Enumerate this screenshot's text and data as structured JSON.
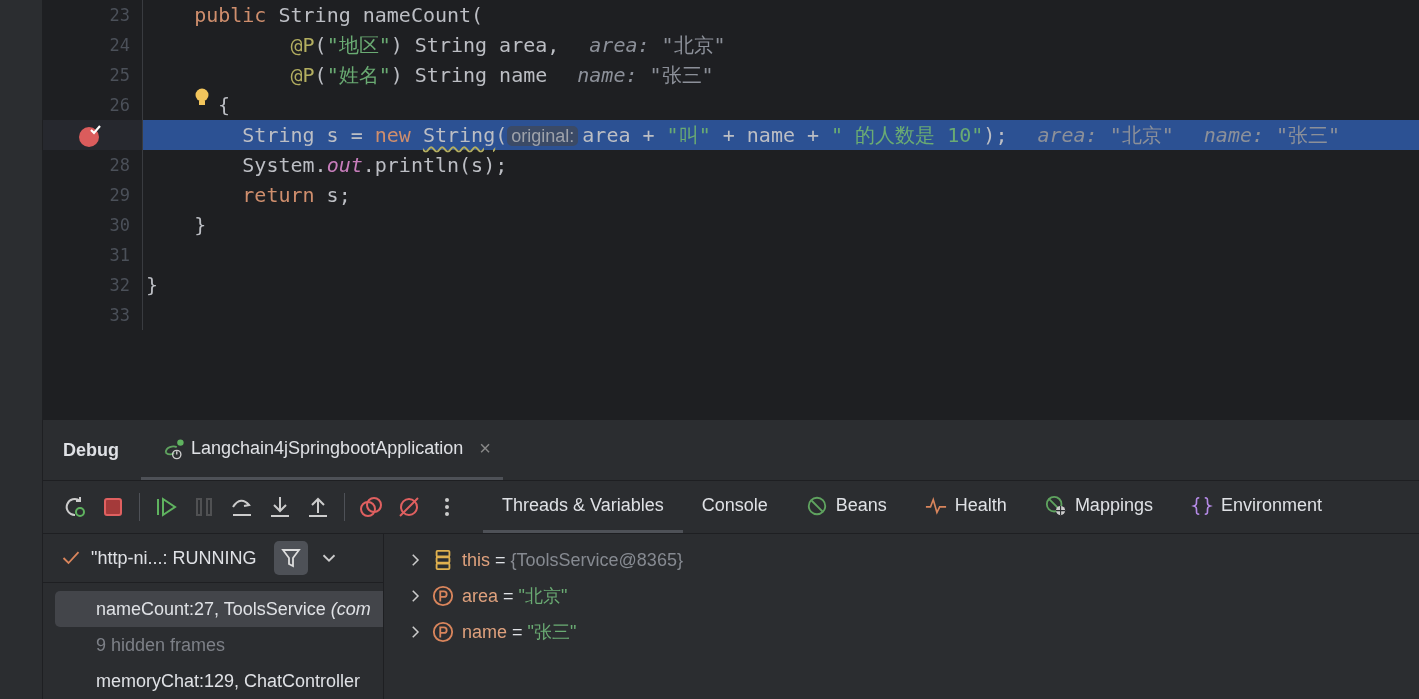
{
  "editor": {
    "lines": [
      {
        "number": "23",
        "current": false,
        "tokens": [
          {
            "t": "    public",
            "kind": "kw"
          },
          {
            "t": " String nameCount(",
            "kind": "plain"
          }
        ]
      },
      {
        "number": "24",
        "current": false,
        "tokens": [
          {
            "t": "            @P",
            "kind": "ann"
          },
          {
            "t": "(",
            "kind": "plain"
          },
          {
            "t": "\"地区\"",
            "kind": "str"
          },
          {
            "t": ") String area,",
            "kind": "plain"
          }
        ],
        "hints": [
          {
            "name": "area:",
            "value": "\"北京\""
          }
        ]
      },
      {
        "number": "25",
        "current": false,
        "tokens": [
          {
            "t": "            @P",
            "kind": "ann"
          },
          {
            "t": "(",
            "kind": "plain"
          },
          {
            "t": "\"姓名\"",
            "kind": "str"
          },
          {
            "t": ") String name",
            "kind": "plain"
          }
        ],
        "hints": [
          {
            "name": "name:",
            "value": "\"张三\""
          }
        ]
      },
      {
        "number": "26",
        "current": false,
        "bulb": true,
        "tokens": [
          {
            "t": "{",
            "kind": "plain"
          }
        ]
      },
      {
        "current": true,
        "breakpoint": true,
        "tokens": [
          {
            "t": "        String s = ",
            "kind": "plain"
          },
          {
            "t": "new ",
            "kind": "kw"
          },
          {
            "t": "String",
            "kind": "warn"
          },
          {
            "t": "(",
            "kind": "plain"
          },
          {
            "t": "original:",
            "kind": "param"
          },
          {
            "t": "area + ",
            "kind": "plain"
          },
          {
            "t": "\"叫\"",
            "kind": "str"
          },
          {
            "t": " + name + ",
            "kind": "plain"
          },
          {
            "t": "\" 的人数是 10\"",
            "kind": "str"
          },
          {
            "t": ");",
            "kind": "plain"
          }
        ],
        "hints": [
          {
            "name": "area:",
            "value": "\"北京\""
          },
          {
            "name": "name:",
            "value": "\"张三\""
          }
        ]
      },
      {
        "number": "28",
        "current": false,
        "tokens": [
          {
            "t": "        System.",
            "kind": "plain"
          },
          {
            "t": "out",
            "kind": "field"
          },
          {
            "t": ".println(s);",
            "kind": "plain"
          }
        ]
      },
      {
        "number": "29",
        "current": false,
        "tokens": [
          {
            "t": "        return",
            "kind": "kw"
          },
          {
            "t": " s;",
            "kind": "plain"
          }
        ]
      },
      {
        "number": "30",
        "current": false,
        "tokens": [
          {
            "t": "    }",
            "kind": "plain"
          }
        ]
      },
      {
        "number": "31",
        "current": false
      },
      {
        "number": "32",
        "current": false,
        "tokens": [
          {
            "t": "}",
            "kind": "plain"
          }
        ]
      },
      {
        "number": "33",
        "current": false
      }
    ]
  },
  "debug": {
    "title": "Debug",
    "session_tab": {
      "label": "Langchain4jSpringbootApplication",
      "close": "×"
    },
    "toolbar": [
      {
        "kind": "rerun"
      },
      {
        "kind": "stop"
      },
      {
        "kind": "sep"
      },
      {
        "kind": "resume"
      },
      {
        "kind": "pause",
        "disabled": true
      },
      {
        "kind": "stepover"
      },
      {
        "kind": "stepinto"
      },
      {
        "kind": "stepout"
      },
      {
        "kind": "sep"
      },
      {
        "kind": "breakpoints"
      },
      {
        "kind": "mute"
      },
      {
        "kind": "more"
      }
    ],
    "tabs": [
      {
        "label": "Threads & Variables",
        "kind": "plain",
        "selected": true
      },
      {
        "label": "Console",
        "kind": "plain",
        "selected": false
      },
      {
        "label": "Beans",
        "kind": "beans",
        "selected": false
      },
      {
        "label": "Health",
        "kind": "health",
        "selected": false
      },
      {
        "label": "Mappings",
        "kind": "mappings",
        "selected": false
      },
      {
        "label": "Environment",
        "kind": "env",
        "selected": false
      }
    ],
    "thread": {
      "label": "\"http-ni...: RUNNING"
    },
    "frames": [
      {
        "kind": "frame",
        "text": "nameCount:27, ToolsService *(com*",
        "selected": true
      },
      {
        "kind": "hidden",
        "text": "9 hidden frames",
        "selected": false
      },
      {
        "kind": "frame",
        "text": "memoryChat:129, ChatController",
        "selected": false
      }
    ],
    "variables": [
      {
        "kind": "object",
        "name": "this",
        "op": "=",
        "value": "{ToolsService@8365}"
      },
      {
        "kind": "string",
        "name": "area",
        "op": "=",
        "value": "\"北京\""
      },
      {
        "kind": "string",
        "name": "name",
        "op": "=",
        "value": "\"张三\""
      }
    ]
  }
}
